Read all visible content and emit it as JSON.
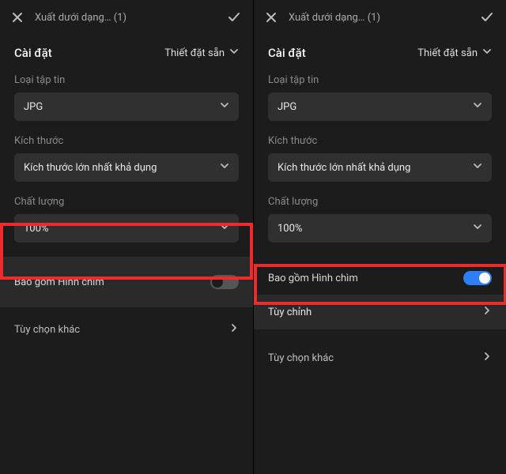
{
  "header": {
    "title": "Xuất dưới dạng… (1)"
  },
  "settings": {
    "heading": "Cài đặt",
    "preset_label": "Thiết đặt sẵn",
    "file_type_label": "Loại tập tin",
    "file_type_value": "JPG",
    "size_label": "Kích thước",
    "size_value": "Kích thước lớn nhất khả dụng",
    "quality_label": "Chất lượng",
    "quality_value": "100%"
  },
  "watermark": {
    "label": "Bao gồm Hình chìm"
  },
  "customize": {
    "label": "Tùy chỉnh"
  },
  "more": {
    "label": "Tùy chọn khác"
  }
}
